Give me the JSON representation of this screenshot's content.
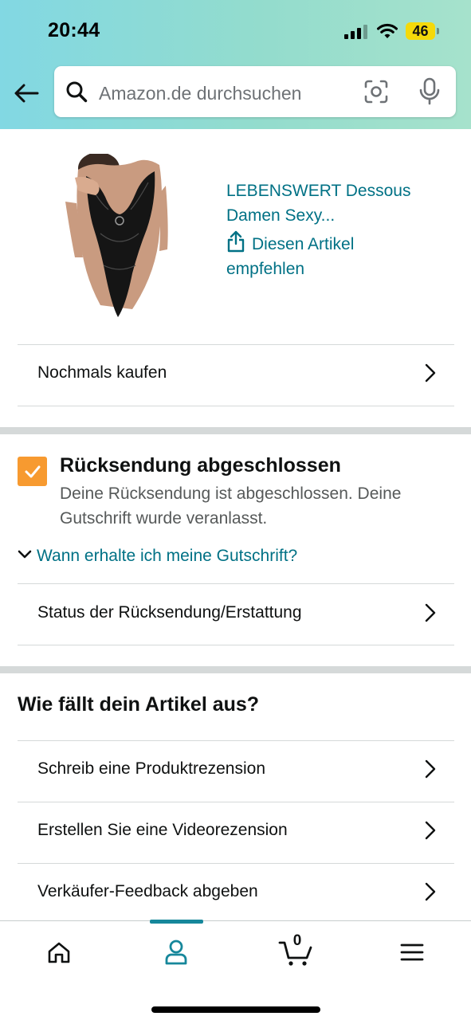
{
  "status_bar": {
    "time": "20:44",
    "battery": "46",
    "battery_color": "#f5d90a"
  },
  "search": {
    "placeholder": "Amazon.de durchsuchen"
  },
  "product": {
    "title_line1": "LEBENSWERT Dessous",
    "title_line2": "Damen Sexy...",
    "share_line1": "Diesen Artikel",
    "share_line2": "empfehlen",
    "buy_again": "Nochmals kaufen"
  },
  "return": {
    "title": "Rücksendung abgeschlossen",
    "description": "Deine Rücksendung ist abgeschlossen. Deine Gutschrift wurde veranlasst.",
    "credit_question": "Wann erhalte ich meine Gutschrift?",
    "status_row": "Status der Rücksendung/Erstattung"
  },
  "review": {
    "heading": "Wie fällt dein Artikel aus?",
    "items": [
      "Schreib eine Produktrezension",
      "Erstellen Sie eine Videorezension",
      "Verkäufer-Feedback abgeben"
    ]
  },
  "bottom_nav": {
    "cart_count": "0",
    "active_tab": "account",
    "active_color": "#16879b"
  },
  "colors": {
    "link": "#007185",
    "checkbox": "#f79a30"
  }
}
